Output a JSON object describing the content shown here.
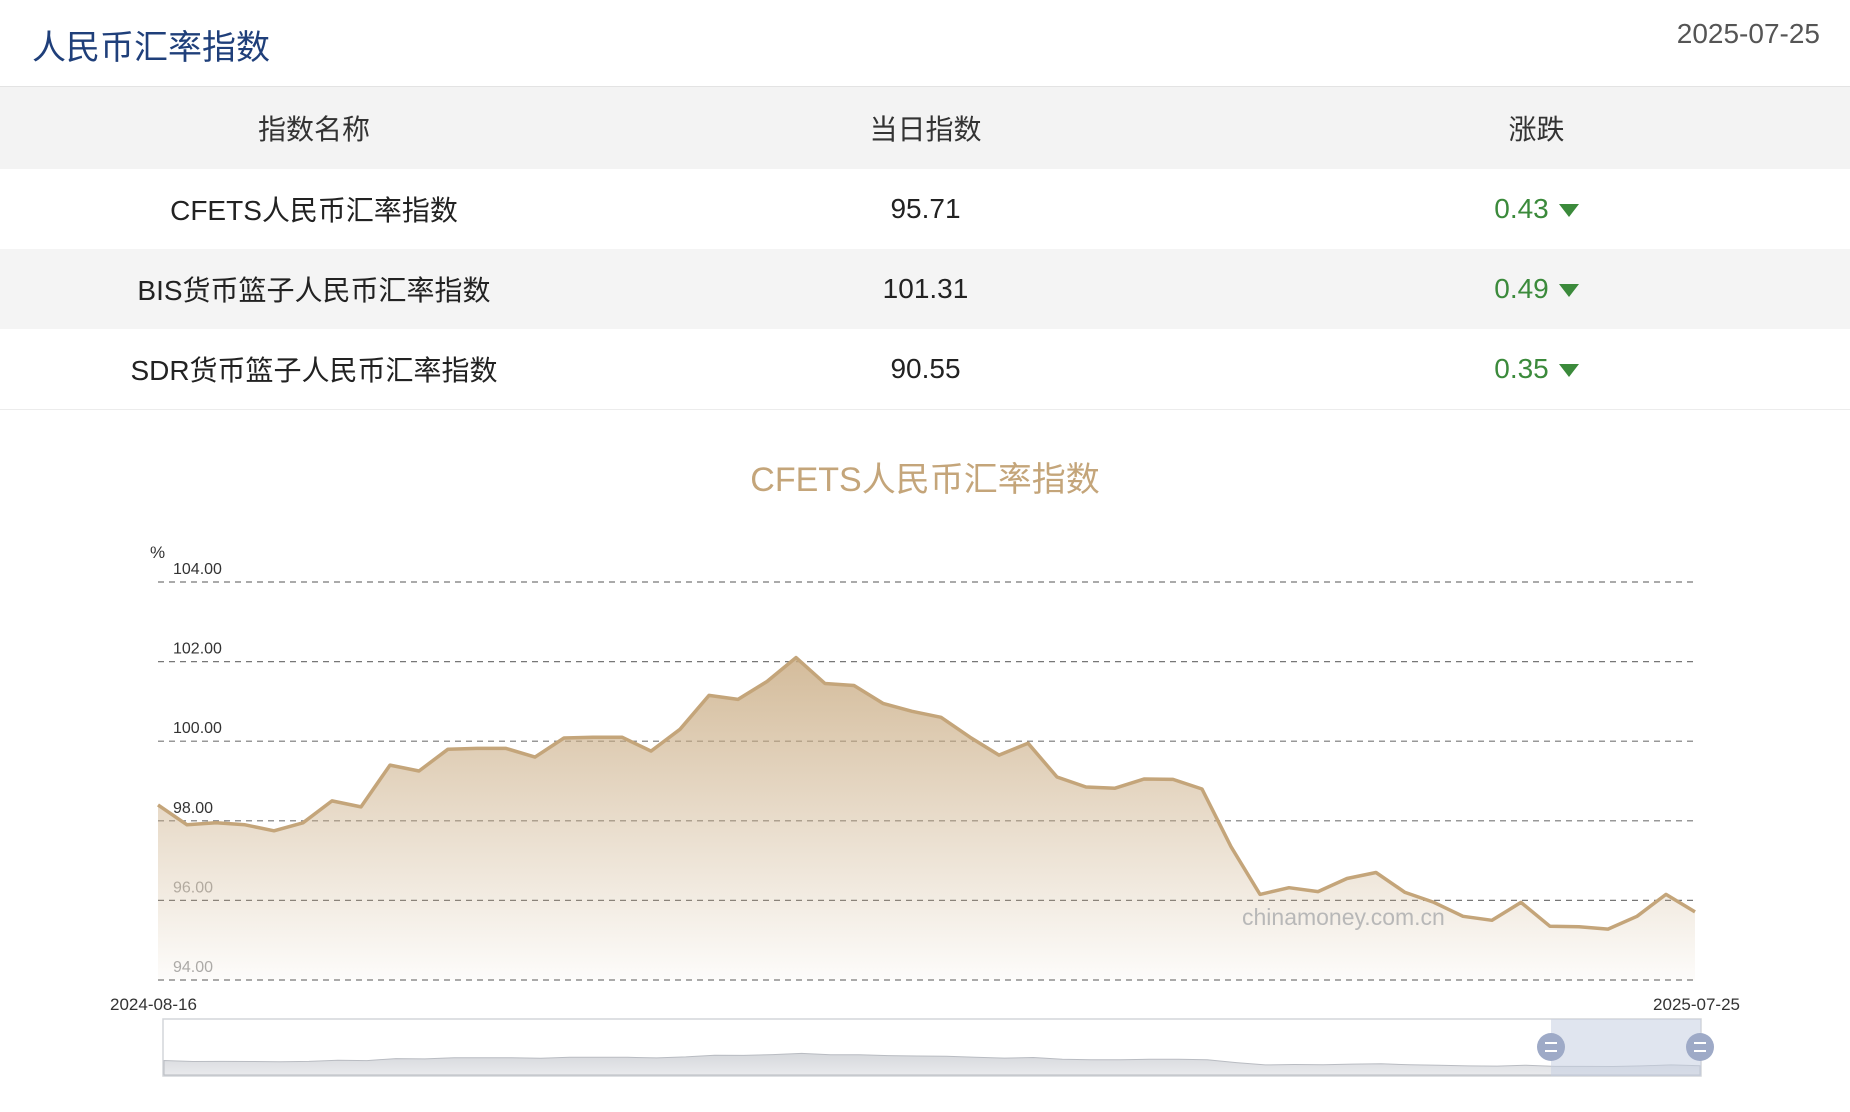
{
  "header": {
    "title": "人民币汇率指数",
    "date": "2025-07-25"
  },
  "table": {
    "columns": [
      "指数名称",
      "当日指数",
      "涨跌"
    ],
    "rows": [
      {
        "name": "CFETS人民币汇率指数",
        "value": "95.71",
        "change": "0.43",
        "direction": "down"
      },
      {
        "name": "BIS货币篮子人民币汇率指数",
        "value": "101.31",
        "change": "0.49",
        "direction": "down"
      },
      {
        "name": "SDR货币篮子人民币汇率指数",
        "value": "90.55",
        "change": "0.35",
        "direction": "down"
      }
    ]
  },
  "colors": {
    "title": "#1f3f7a",
    "change_down": "#3b8a3b",
    "chart_line": "#c4a57a",
    "chart_title": "#c4a57a"
  },
  "chart_data": {
    "type": "area",
    "title": "CFETS人民币汇率指数",
    "yunit": "%",
    "ylim": [
      94,
      104
    ],
    "yticks": [
      "104.00",
      "102.00",
      "100.00",
      "98.00",
      "96.00",
      "94.00"
    ],
    "x_start_label": "2024-08-16",
    "x_end_label": "2025-07-25",
    "grid": true,
    "watermark": "chinamoney.com.cn",
    "series": [
      {
        "values": [
          98.4,
          97.9,
          97.95,
          97.9,
          97.75,
          97.95,
          98.5,
          98.35,
          99.4,
          99.25,
          99.8,
          99.82,
          99.82,
          99.6,
          100.08,
          100.1,
          100.1,
          99.75,
          100.3,
          101.15,
          101.05,
          101.5,
          102.1,
          101.45,
          101.4,
          100.95,
          100.75,
          100.6,
          100.1,
          99.65,
          99.95,
          99.1,
          98.85,
          98.82,
          99.05,
          99.04,
          98.8,
          97.35,
          96.15,
          96.32,
          96.22,
          96.55,
          96.7,
          96.2,
          95.95,
          95.6,
          95.5,
          95.95,
          95.35,
          95.34,
          95.28,
          95.6,
          96.15,
          95.71
        ]
      }
    ]
  }
}
